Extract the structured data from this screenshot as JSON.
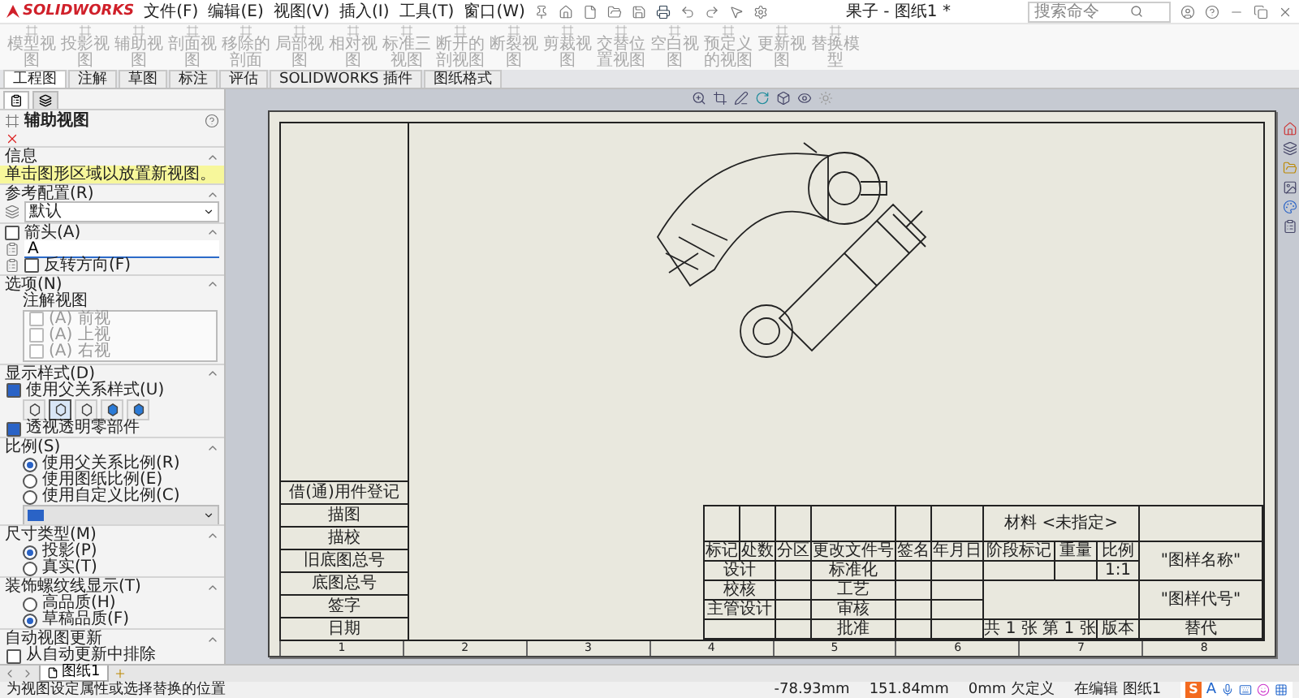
{
  "app": {
    "logo": "SOLIDWORKS",
    "menus": [
      "文件(F)",
      "编辑(E)",
      "视图(V)",
      "插入(I)",
      "工具(T)",
      "窗口(W)"
    ],
    "document_title": "果子 - 图纸1 *",
    "search": {
      "placeholder": "搜索命令"
    }
  },
  "ribbon": [
    {
      "label": "模型视图",
      "disabled": true
    },
    {
      "label": "投影视图",
      "disabled": true
    },
    {
      "label": "辅助视图",
      "disabled": true
    },
    {
      "label": "剖面视图",
      "disabled": true
    },
    {
      "label": "移除的剖面",
      "disabled": true
    },
    {
      "label": "局部视图",
      "disabled": true
    },
    {
      "label": "相对视图",
      "disabled": true
    },
    {
      "label": "标准三视图",
      "disabled": true
    },
    {
      "label": "断开的剖视图",
      "disabled": true
    },
    {
      "label": "断裂视图",
      "disabled": true
    },
    {
      "label": "剪裁视图",
      "disabled": true
    },
    {
      "label": "交替位置视图",
      "disabled": true
    },
    {
      "label": "空白视图",
      "disabled": true
    },
    {
      "label": "预定义的视图",
      "disabled": true
    },
    {
      "label": "更新视图",
      "disabled": true
    },
    {
      "label": "替换模型",
      "disabled": true
    }
  ],
  "command_tabs": [
    {
      "label": "工程图",
      "selected": true
    },
    {
      "label": "注解",
      "selected": false
    },
    {
      "label": "草图",
      "selected": false
    },
    {
      "label": "标注",
      "selected": false
    },
    {
      "label": "评估",
      "selected": false
    },
    {
      "label": "SOLIDWORKS 插件",
      "selected": false
    },
    {
      "label": "图纸格式",
      "selected": false
    }
  ],
  "panel": {
    "tabs": [
      {
        "selected": true
      },
      {
        "selected": false
      }
    ],
    "title": "辅助视图",
    "sections": [
      {
        "title": "信息",
        "expanded": true,
        "rows": [
          {
            "kind": "message",
            "text": "单击图形区域以放置新视图。"
          }
        ]
      },
      {
        "title": "参考配置(R)",
        "expanded": true,
        "rows": [
          {
            "kind": "dropdown",
            "value": "默认",
            "disabled": false
          }
        ]
      },
      {
        "title": "箭头(A)",
        "expanded": true,
        "checked": false,
        "rows": [
          {
            "kind": "field",
            "value": "A"
          },
          {
            "kind": "icon-checkbox",
            "label": "反转方向(F)",
            "checked": false,
            "disabled": false
          }
        ]
      },
      {
        "title": "选项(N)",
        "expanded": true,
        "rows": [
          {
            "kind": "label",
            "text": "注解视图"
          },
          {
            "kind": "listbox",
            "items": [
              {
                "label": "(A) 前视",
                "checked": false,
                "disabled": true
              },
              {
                "label": "(A) 上视",
                "checked": false,
                "disabled": true
              },
              {
                "label": "(A) 右视",
                "checked": false,
                "disabled": true
              }
            ]
          }
        ]
      },
      {
        "title": "显示样式(D)",
        "expanded": true,
        "rows": [
          {
            "kind": "checkbox",
            "label": "使用父关系样式(U)",
            "checked": true,
            "disabled": false
          },
          {
            "kind": "styles",
            "items": [
              {
                "selected": false
              },
              {
                "selected": true
              },
              {
                "selected": false
              },
              {
                "selected": false
              },
              {
                "selected": false
              }
            ]
          },
          {
            "kind": "checkbox",
            "label": "透视透明零部件",
            "checked": true,
            "disabled": false
          }
        ]
      },
      {
        "title": "比例(S)",
        "expanded": true,
        "rows": [
          {
            "kind": "radio",
            "label": "使用父关系比例(R)",
            "selected": true
          },
          {
            "kind": "radio",
            "label": "使用图纸比例(E)",
            "selected": false
          },
          {
            "kind": "radio",
            "label": "使用自定义比例(C)",
            "selected": false
          },
          {
            "kind": "swatch-dropdown",
            "disabled": true
          }
        ]
      },
      {
        "title": "尺寸类型(M)",
        "expanded": true,
        "rows": [
          {
            "kind": "radio",
            "label": "投影(P)",
            "selected": true
          },
          {
            "kind": "radio",
            "label": "真实(T)",
            "selected": false
          }
        ]
      },
      {
        "title": "装饰螺纹线显示(T)",
        "expanded": true,
        "rows": [
          {
            "kind": "radio",
            "label": "高品质(H)",
            "selected": false
          },
          {
            "kind": "radio",
            "label": "草稿品质(F)",
            "selected": true
          }
        ]
      },
      {
        "title": "自动视图更新",
        "expanded": true,
        "rows": [
          {
            "kind": "checkbox",
            "label": "从自动更新中排除",
            "checked": false,
            "disabled": false
          }
        ]
      }
    ]
  },
  "sheet": {
    "zones": [
      "1",
      "2",
      "3",
      "4",
      "5",
      "6",
      "7",
      "8"
    ],
    "side_labels": [
      "借(通)用件登记",
      "描图",
      "描校",
      "旧底图总号",
      "底图总号",
      "签字",
      "日期"
    ],
    "title_block": {
      "material": "材料 <未指定>",
      "drawing_name": "\"图样名称\"",
      "drawing_number": "\"图样代号\"",
      "revision_headers": [
        "标记",
        "处数",
        "分区",
        "更改文件号",
        "签名",
        "年月日"
      ],
      "left_roles": [
        "设计",
        "校核",
        "主管设计"
      ],
      "right_roles": [
        "标准化",
        "工艺",
        "审核",
        "批准"
      ],
      "stage_headers": [
        "阶段标记",
        "重量",
        "比例"
      ],
      "scale": "1:1",
      "sheet_count": "共 1 张 第 1 张",
      "version": "版本",
      "replaces": "替代"
    }
  },
  "sheet_tabs": [
    {
      "label": "图纸1",
      "selected": true
    }
  ],
  "status_bar": {
    "message": "为视图设定属性或选择替换的位置",
    "items": [
      "-78.93mm",
      "151.84mm",
      "0mm 欠定义",
      "在编辑 图纸1"
    ],
    "ime": {
      "logo": "S",
      "mode": "A"
    }
  }
}
